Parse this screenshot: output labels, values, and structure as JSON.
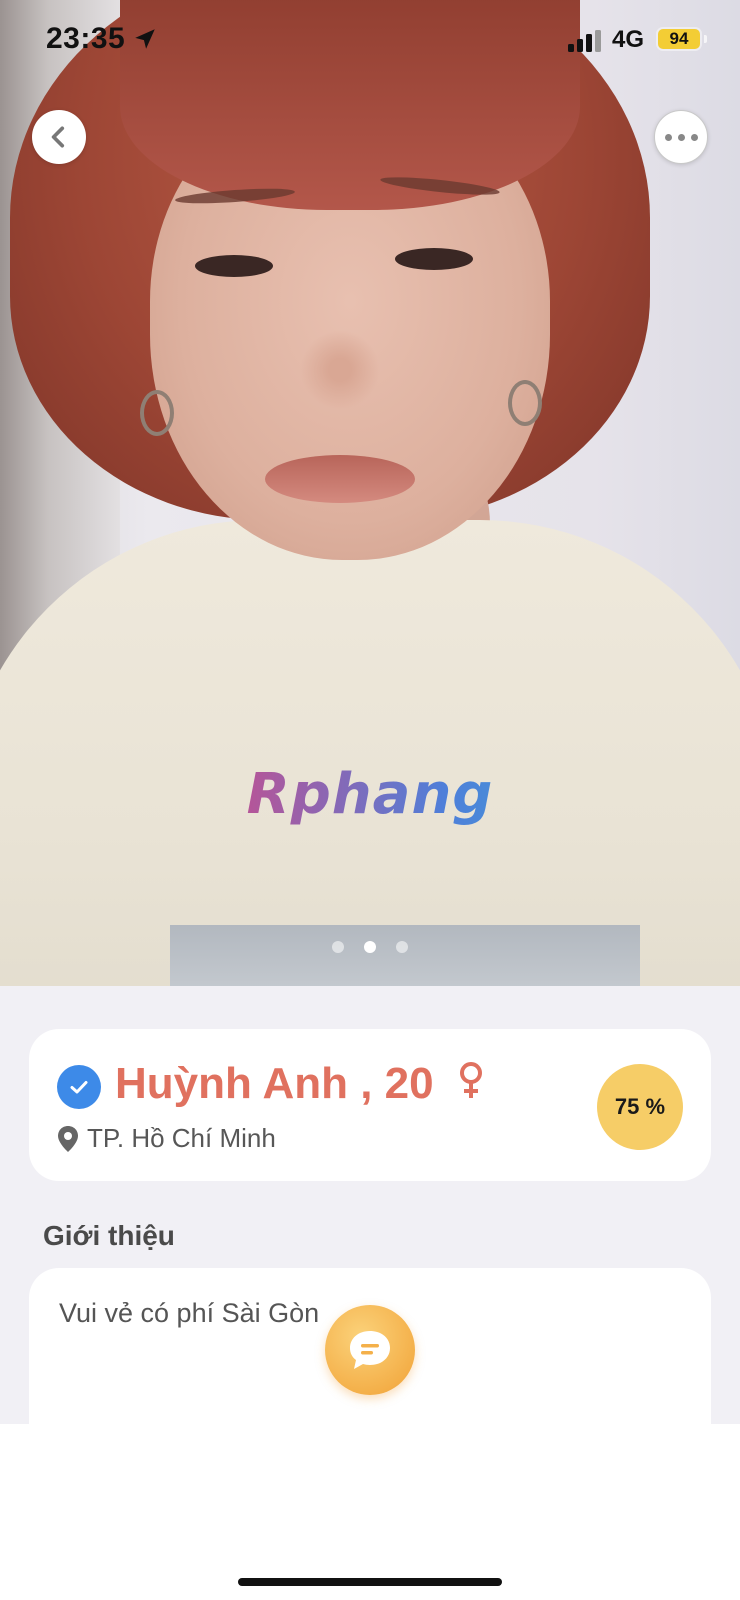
{
  "status_bar": {
    "time": "23:35",
    "network": "4G",
    "battery_level": "94",
    "icons": [
      "location-arrow-icon",
      "signal-icon",
      "battery-icon"
    ]
  },
  "photo": {
    "watermark": "Rphang",
    "page_count": 3,
    "active_page": 2,
    "icons": {
      "back": "chevron-left-icon",
      "more": "more-dots-icon"
    }
  },
  "profile": {
    "name_age": "Huỳnh Anh , 20",
    "gender_symbol": "female-icon",
    "verified_icon": "check-badge-icon",
    "location_icon": "map-pin-icon",
    "location": "TP. Hồ Chí Minh",
    "match_percent": "75 %"
  },
  "intro": {
    "title": "Giới thiệu",
    "text": "Vui vẻ có phí Sài Gòn"
  },
  "chat_button": {
    "icon": "chat-bubble-icon"
  },
  "colors": {
    "accent_name": "#e0715f",
    "verified_blue": "#3d8ae8",
    "match_badge": "#f6cd67",
    "chat_fab": "#f4b04a",
    "battery": "#f3cd35",
    "background": "#f1f0f5"
  }
}
